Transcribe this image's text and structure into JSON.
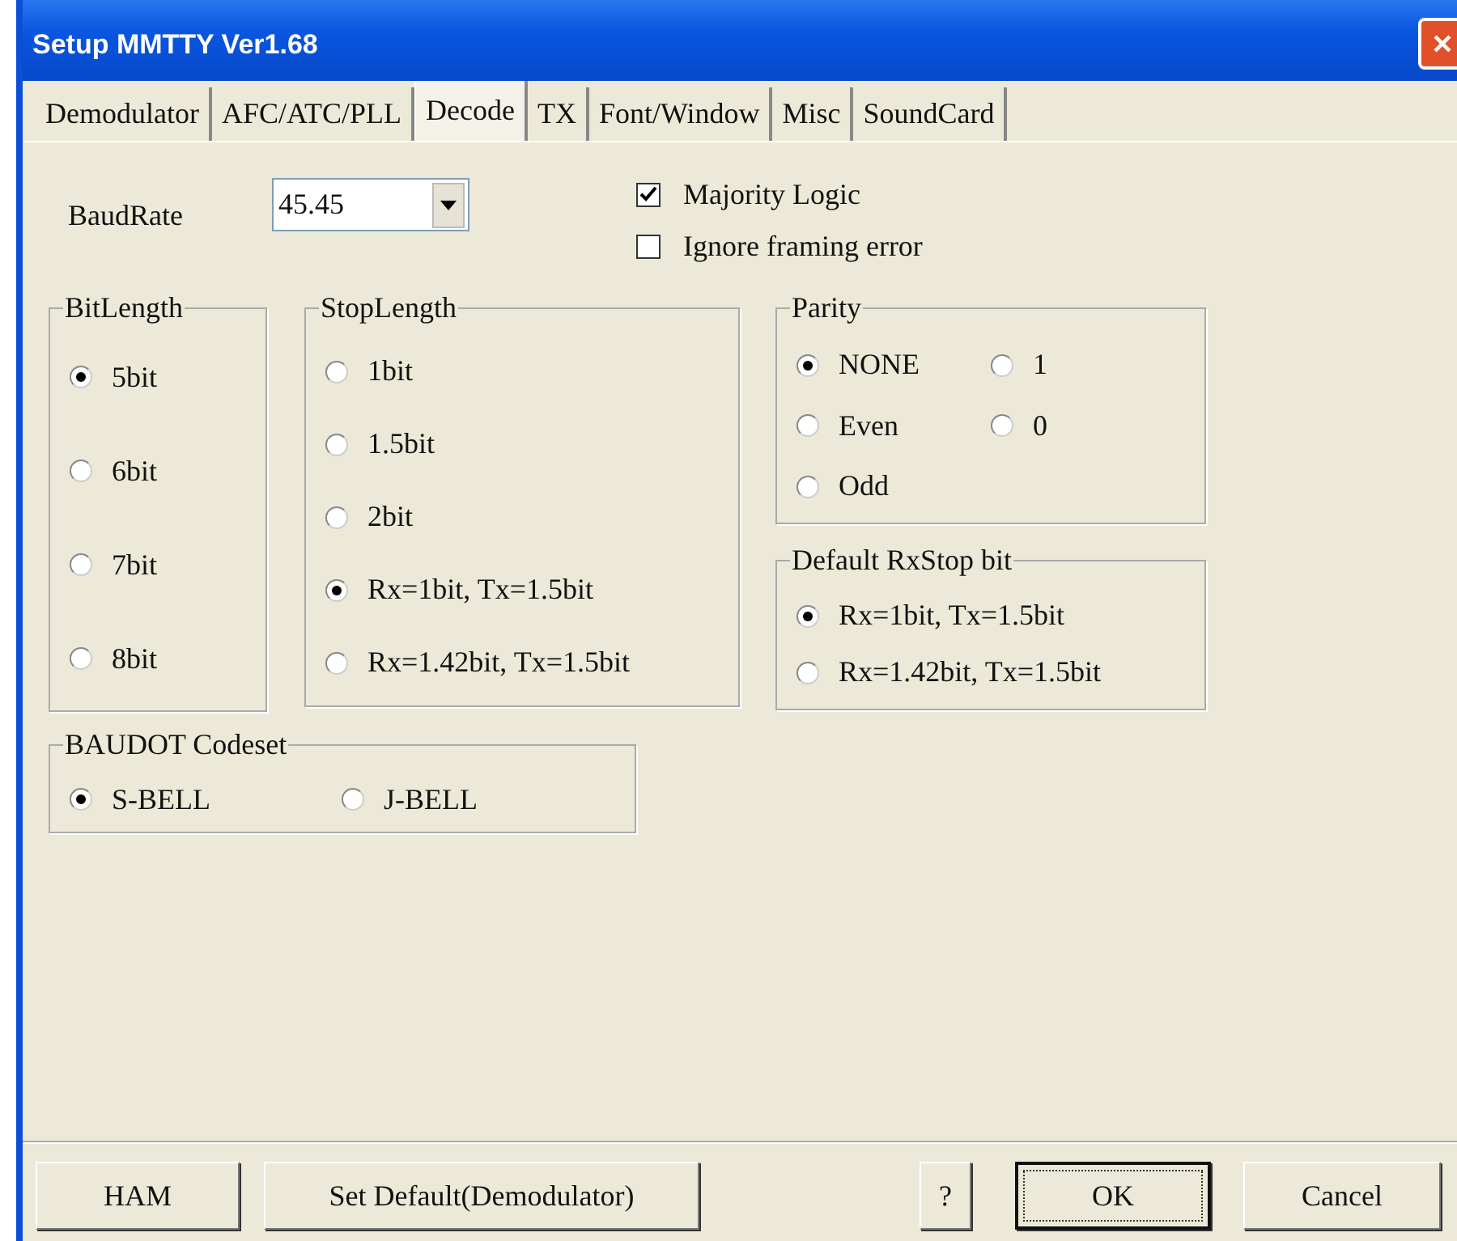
{
  "window": {
    "title": "Setup MMTTY Ver1.68"
  },
  "tabs": [
    {
      "label": "Demodulator",
      "selected": false
    },
    {
      "label": "AFC/ATC/PLL",
      "selected": false
    },
    {
      "label": "Decode",
      "selected": true
    },
    {
      "label": "TX",
      "selected": false
    },
    {
      "label": "Font/Window",
      "selected": false
    },
    {
      "label": "Misc",
      "selected": false
    },
    {
      "label": "SoundCard",
      "selected": false
    }
  ],
  "baud_rate": {
    "label": "BaudRate",
    "value": "45.45"
  },
  "checkboxes": [
    {
      "label": "Majority Logic",
      "checked": true
    },
    {
      "label": "Ignore framing error",
      "checked": false
    }
  ],
  "bit_length": {
    "title": "BitLength",
    "options": [
      {
        "label": "5bit",
        "selected": true
      },
      {
        "label": "6bit",
        "selected": false
      },
      {
        "label": "7bit",
        "selected": false
      },
      {
        "label": "8bit",
        "selected": false
      }
    ]
  },
  "stop_length": {
    "title": "StopLength",
    "options": [
      {
        "label": "1bit",
        "selected": false
      },
      {
        "label": "1.5bit",
        "selected": false
      },
      {
        "label": "2bit",
        "selected": false
      },
      {
        "label": "Rx=1bit, Tx=1.5bit",
        "selected": true
      },
      {
        "label": "Rx=1.42bit, Tx=1.5bit",
        "selected": false
      }
    ]
  },
  "parity": {
    "title": "Parity",
    "options": [
      {
        "label": "NONE",
        "selected": true
      },
      {
        "label": "1",
        "selected": false
      },
      {
        "label": "Even",
        "selected": false
      },
      {
        "label": "0",
        "selected": false
      },
      {
        "label": "Odd",
        "selected": false
      }
    ]
  },
  "default_rxstop": {
    "title": "Default RxStop bit",
    "options": [
      {
        "label": "Rx=1bit, Tx=1.5bit",
        "selected": true
      },
      {
        "label": "Rx=1.42bit, Tx=1.5bit",
        "selected": false
      }
    ]
  },
  "baudot_codeset": {
    "title": "BAUDOT Codeset",
    "options": [
      {
        "label": "S-BELL",
        "selected": true
      },
      {
        "label": "J-BELL",
        "selected": false
      }
    ]
  },
  "buttons": [
    {
      "label": "HAM",
      "focused": false
    },
    {
      "label": "Set Default(Demodulator)",
      "focused": false
    },
    {
      "label": "?",
      "focused": false
    },
    {
      "label": "OK",
      "focused": true
    },
    {
      "label": "Cancel",
      "focused": false
    }
  ]
}
